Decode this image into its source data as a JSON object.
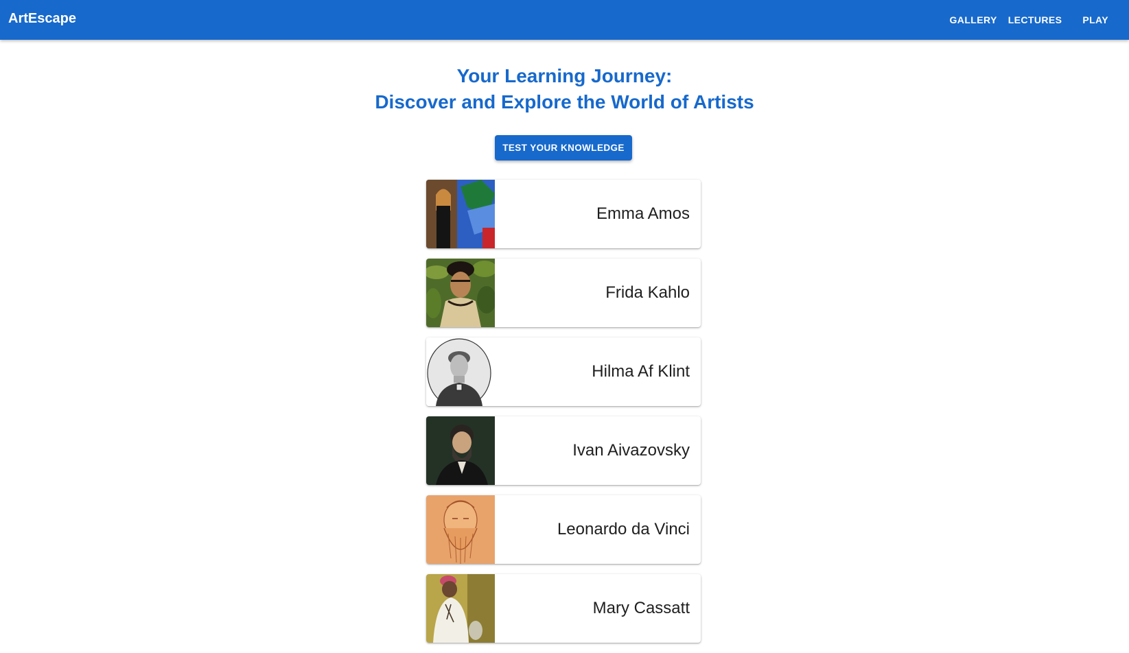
{
  "app": {
    "brand": "ArtEscape",
    "nav": [
      "GALLERY",
      "LECTURES",
      "PLAY"
    ]
  },
  "hero": {
    "title_line1": "Your Learning Journey:",
    "title_line2": "Discover and Explore the World of Artists",
    "cta_label": "TEST YOUR KNOWLEDGE"
  },
  "artists": [
    {
      "name": "Emma Amos"
    },
    {
      "name": "Frida Kahlo"
    },
    {
      "name": "Hilma Af Klint"
    },
    {
      "name": "Ivan Aivazovsky"
    },
    {
      "name": "Leonardo da Vinci"
    },
    {
      "name": "Mary Cassatt"
    }
  ],
  "colors": {
    "primary": "#1769cc",
    "text": "#1f1f1f",
    "background": "#ffffff"
  }
}
